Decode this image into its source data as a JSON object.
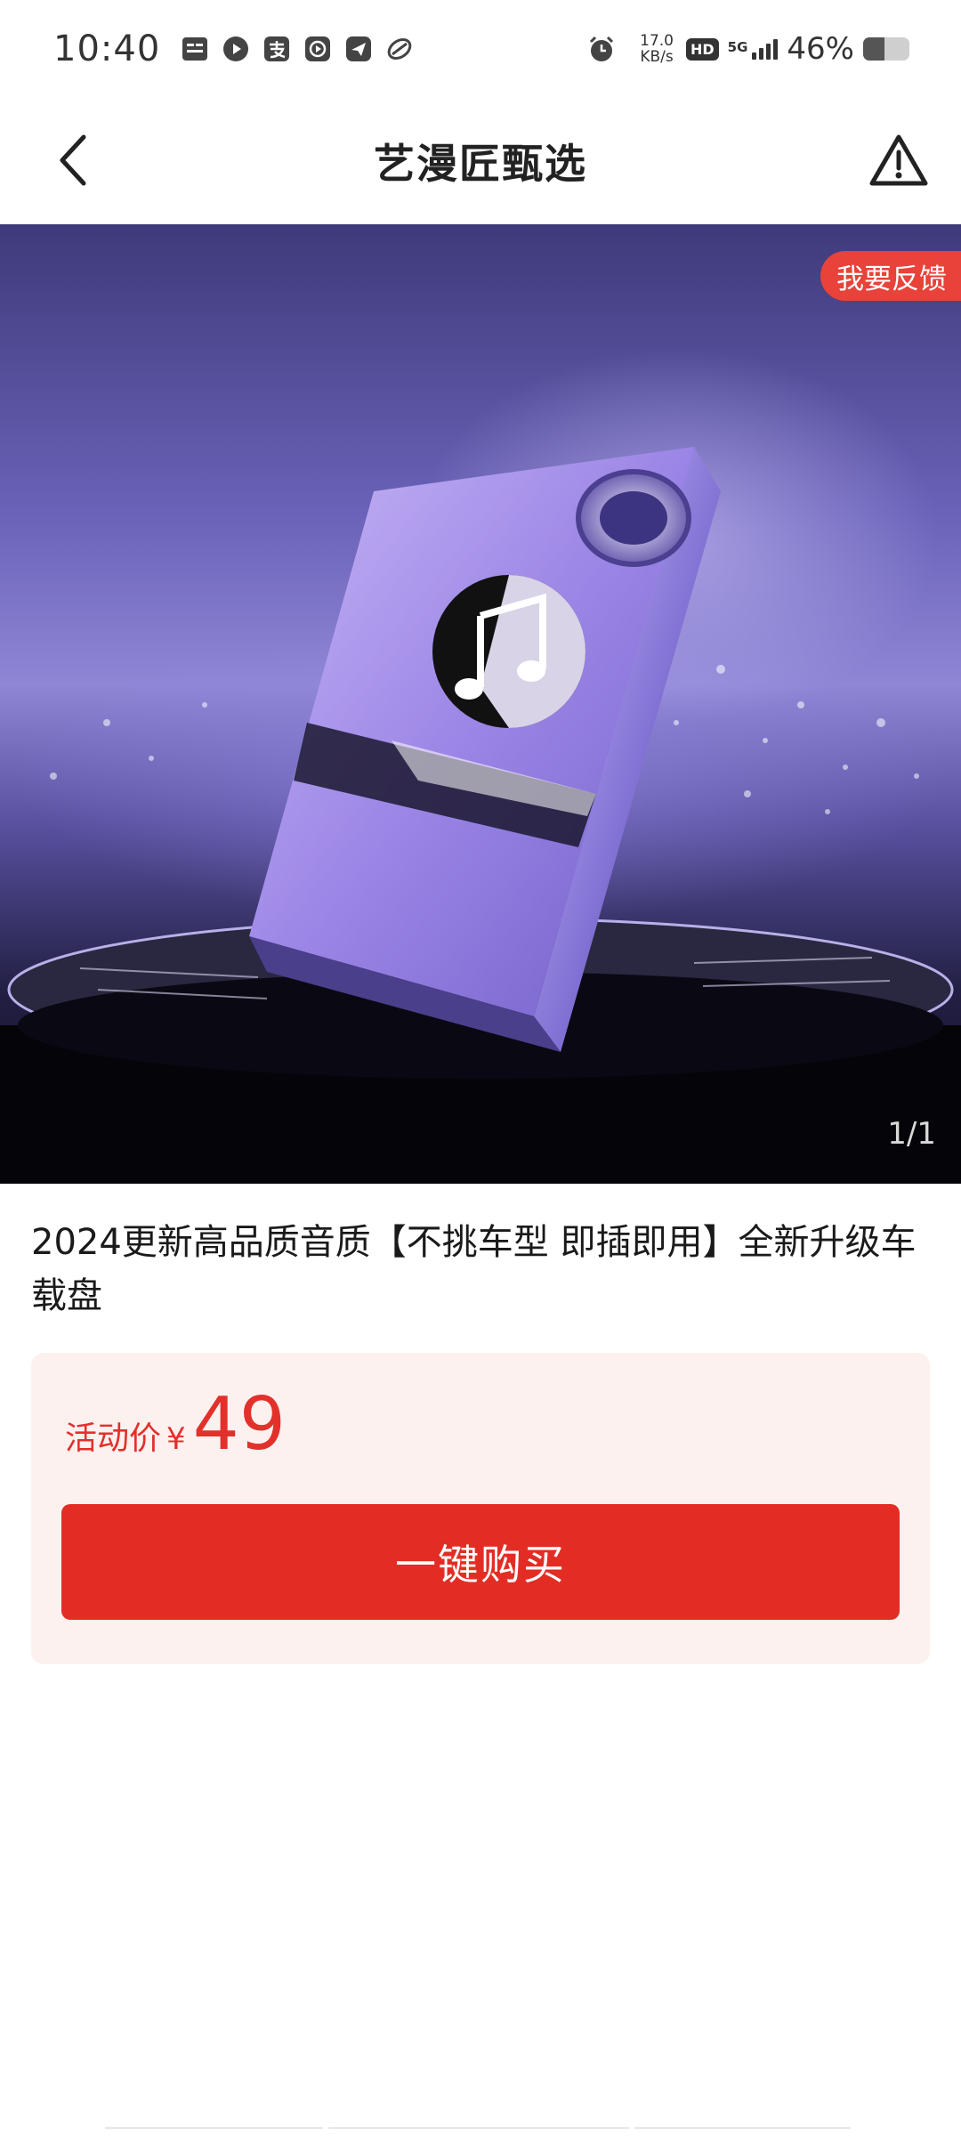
{
  "status_bar": {
    "time": "10:40",
    "notification_icons": [
      "toutiao-icon",
      "play-circle-icon",
      "alipay-icon",
      "video-play-icon",
      "send-icon",
      "leaf-icon"
    ],
    "net_speed_value": "17.0",
    "net_speed_unit": "KB/s",
    "hd_badge": "HD",
    "network_type": "5G",
    "battery_percent": "46%",
    "battery_level": 0.46
  },
  "nav": {
    "title": "艺漫匠甄选",
    "back_icon": "chevron-left-icon",
    "report_icon": "warning-triangle-icon"
  },
  "product_image": {
    "feedback_label": "我要反馈",
    "counter": "1/1"
  },
  "product": {
    "title": "2024更新高品质音质【不挑车型 即插即用】全新升级车载盘"
  },
  "price": {
    "label": "活动价",
    "currency": "¥",
    "value": "49",
    "buy_label": "一键购买"
  },
  "colors": {
    "accent_red": "#e32d24",
    "price_red": "#e2312b",
    "card_bg": "#fdf1f0"
  }
}
